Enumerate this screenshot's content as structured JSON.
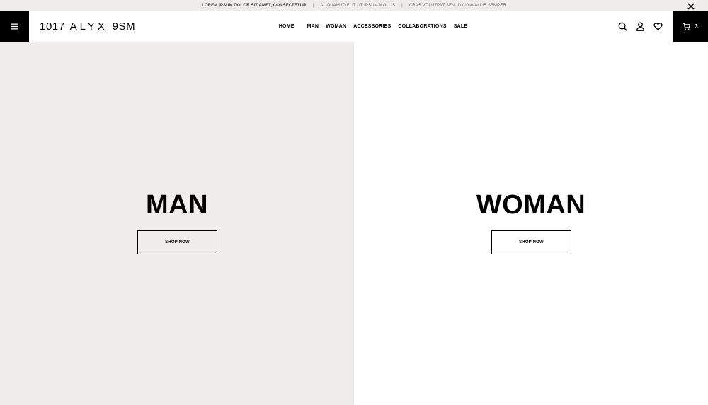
{
  "announcement": {
    "items": [
      "LOREM IPSUM DOLOR SIT AMET, CONSECTETUR",
      "ALIQUAM ID ELIT UT IPSUM MOLLIS",
      "CRAS VOLUTPAT SEM ID CONVALLIS SEMPER"
    ],
    "separator": "|",
    "active_index": 0
  },
  "header": {
    "logo": {
      "left": "1017",
      "mid": "ALYX",
      "right": "9SM"
    },
    "nav": [
      "HOME",
      "MAN",
      "WOMAN",
      "ACCESSORIES",
      "COLLABORATIONS",
      "SALE"
    ],
    "cart_count": "3"
  },
  "hero": {
    "man": {
      "title": "MAN",
      "cta": "SHOP NOW"
    },
    "woman": {
      "title": "WOMAN",
      "cta": "SHOP NOW"
    }
  },
  "icons": [
    "close-icon",
    "hamburger-menu-icon",
    "search-icon",
    "user-icon",
    "heart-icon",
    "cart-icon"
  ],
  "colors": {
    "panel_gray": "#eeedeb",
    "black": "#000000",
    "white": "#ffffff"
  }
}
